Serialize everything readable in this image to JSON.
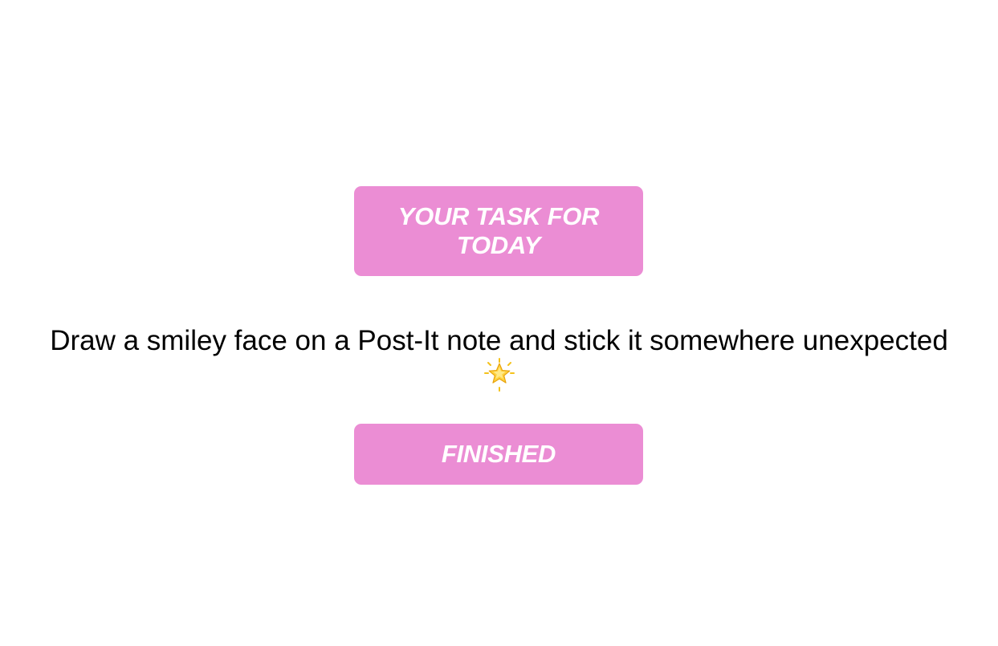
{
  "header": {
    "title": "YOUR TASK FOR TODAY"
  },
  "task": {
    "text": "Draw a smiley face on a Post-It note and stick it somewhere unexpected",
    "emoji_icon": "glowing-star-icon"
  },
  "actions": {
    "finished_label": "FINISHED"
  },
  "colors": {
    "accent": "#eb8dd4",
    "button_text": "#ffffff",
    "body_text": "#000000",
    "background": "#ffffff"
  }
}
